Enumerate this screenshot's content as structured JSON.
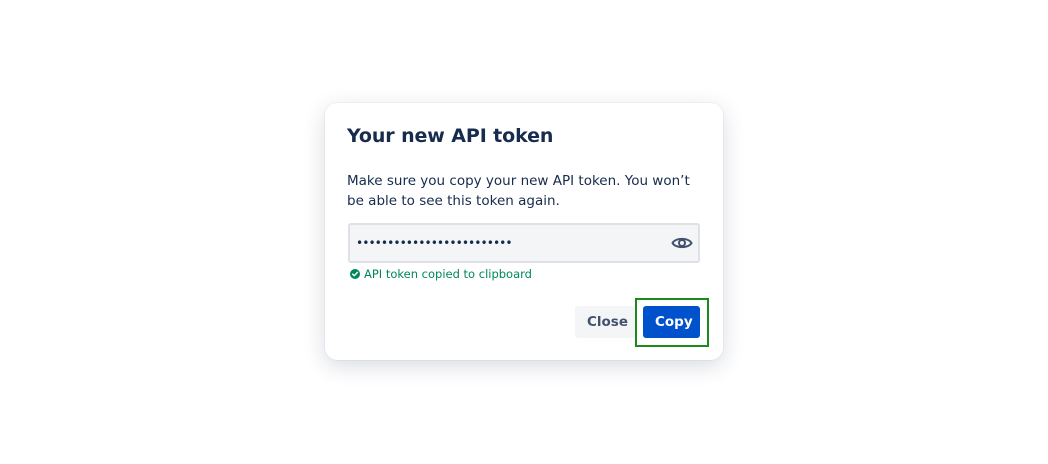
{
  "dialog": {
    "title": "Your new API token",
    "description": "Make sure you copy your new API token. You won’t be able to see this token again.",
    "token_value": "•••••••••••••••••••••••••",
    "reveal_icon": "eye-icon",
    "success_icon": "check-circle-icon",
    "success_message": "API token copied to clipboard",
    "close_label": "Close",
    "copy_label": "Copy"
  },
  "colors": {
    "primary": "#0052cc",
    "success": "#00875a",
    "text": "#172b4d",
    "focus_ring": "#1b8a1b"
  }
}
